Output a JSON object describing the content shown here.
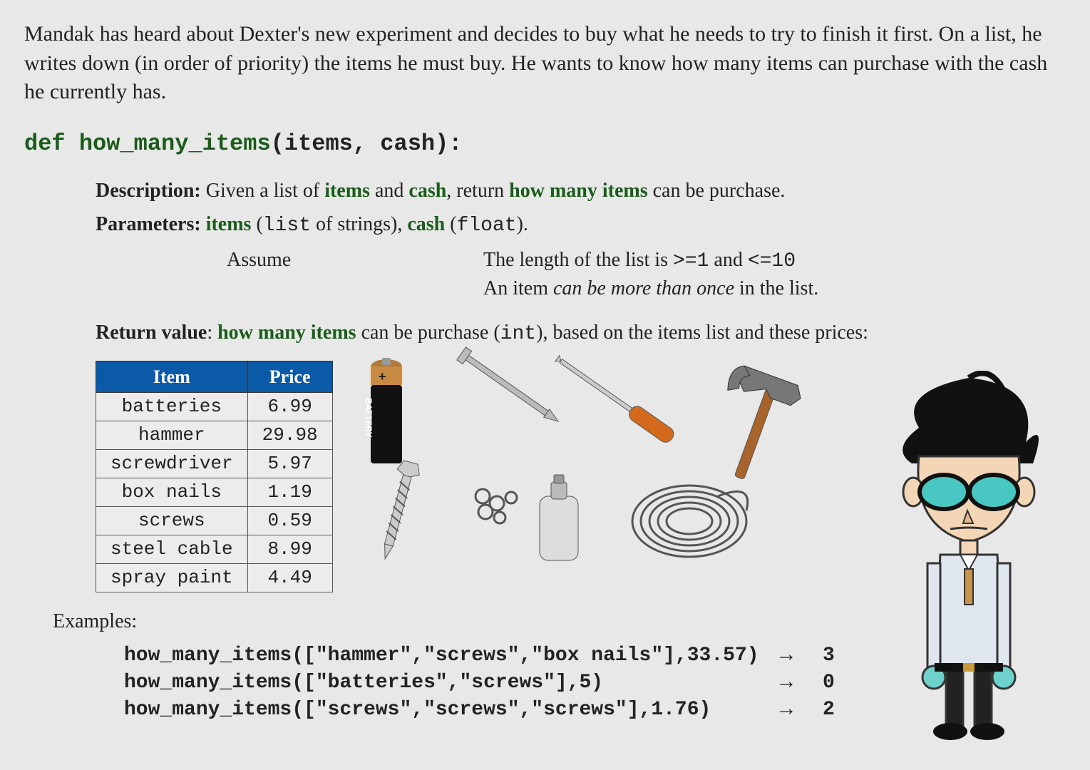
{
  "intro": "Mandak has heard about Dexter's new experiment and decides to buy what he needs to try to finish it first. On a list, he writes down (in order of priority) the items he must buy. He wants to know how many items can purchase with the cash he currently has.",
  "signature": {
    "def": "def",
    "name": "how_many_items",
    "open": "(",
    "params": "items, cash",
    "close": "):"
  },
  "description": {
    "label": "Description:",
    "pre": " Given a list of ",
    "items": "items",
    "mid": " and ",
    "cash": "cash",
    "post": ", return ",
    "hmi": "how many items",
    "tail": " can be purchase."
  },
  "parameters": {
    "label": "Parameters:",
    "text_pre": " ",
    "items": "items",
    "items_type_open": " (",
    "items_type": "list",
    "items_type_close": " of strings), ",
    "cash": "cash",
    "cash_sp": " ",
    "cash_type_open": "(",
    "cash_type": "float",
    "cash_type_close": ").",
    "assume_label": "Assume",
    "assume_line1_a": "The length of the list is ",
    "assume_line1_b": ">=1",
    "assume_line1_c": " and ",
    "assume_line1_d": "<=10",
    "assume_line2_a": "An item ",
    "assume_line2_b": "can be more than once",
    "assume_line2_c": " in the list."
  },
  "return_value": {
    "label": "Return value",
    "colon": ": ",
    "hmi": "how many items",
    "post": " can be purchase ",
    "type_open": "(",
    "type": "int",
    "type_close": ")",
    "tail": ", based on the items list and these prices:"
  },
  "table": {
    "headers": [
      "Item",
      "Price"
    ],
    "rows": [
      [
        "batteries",
        "6.99"
      ],
      [
        "hammer",
        "29.98"
      ],
      [
        "screwdriver",
        "5.97"
      ],
      [
        "box nails",
        "1.19"
      ],
      [
        "screws",
        "0.59"
      ],
      [
        "steel cable",
        "8.99"
      ],
      [
        "spray paint",
        "4.49"
      ]
    ]
  },
  "battery_label": "BATTERY",
  "examples_label": "Examples:",
  "examples": [
    {
      "call": "how_many_items([\"hammer\",\"screws\",\"box nails\"],33.57)",
      "arrow": "→",
      "out": "3"
    },
    {
      "call": "how_many_items([\"batteries\",\"screws\"],5)",
      "arrow": "→",
      "out": "0"
    },
    {
      "call": "how_many_items([\"screws\",\"screws\",\"screws\"],1.76)",
      "arrow": "→",
      "out": "2"
    }
  ]
}
